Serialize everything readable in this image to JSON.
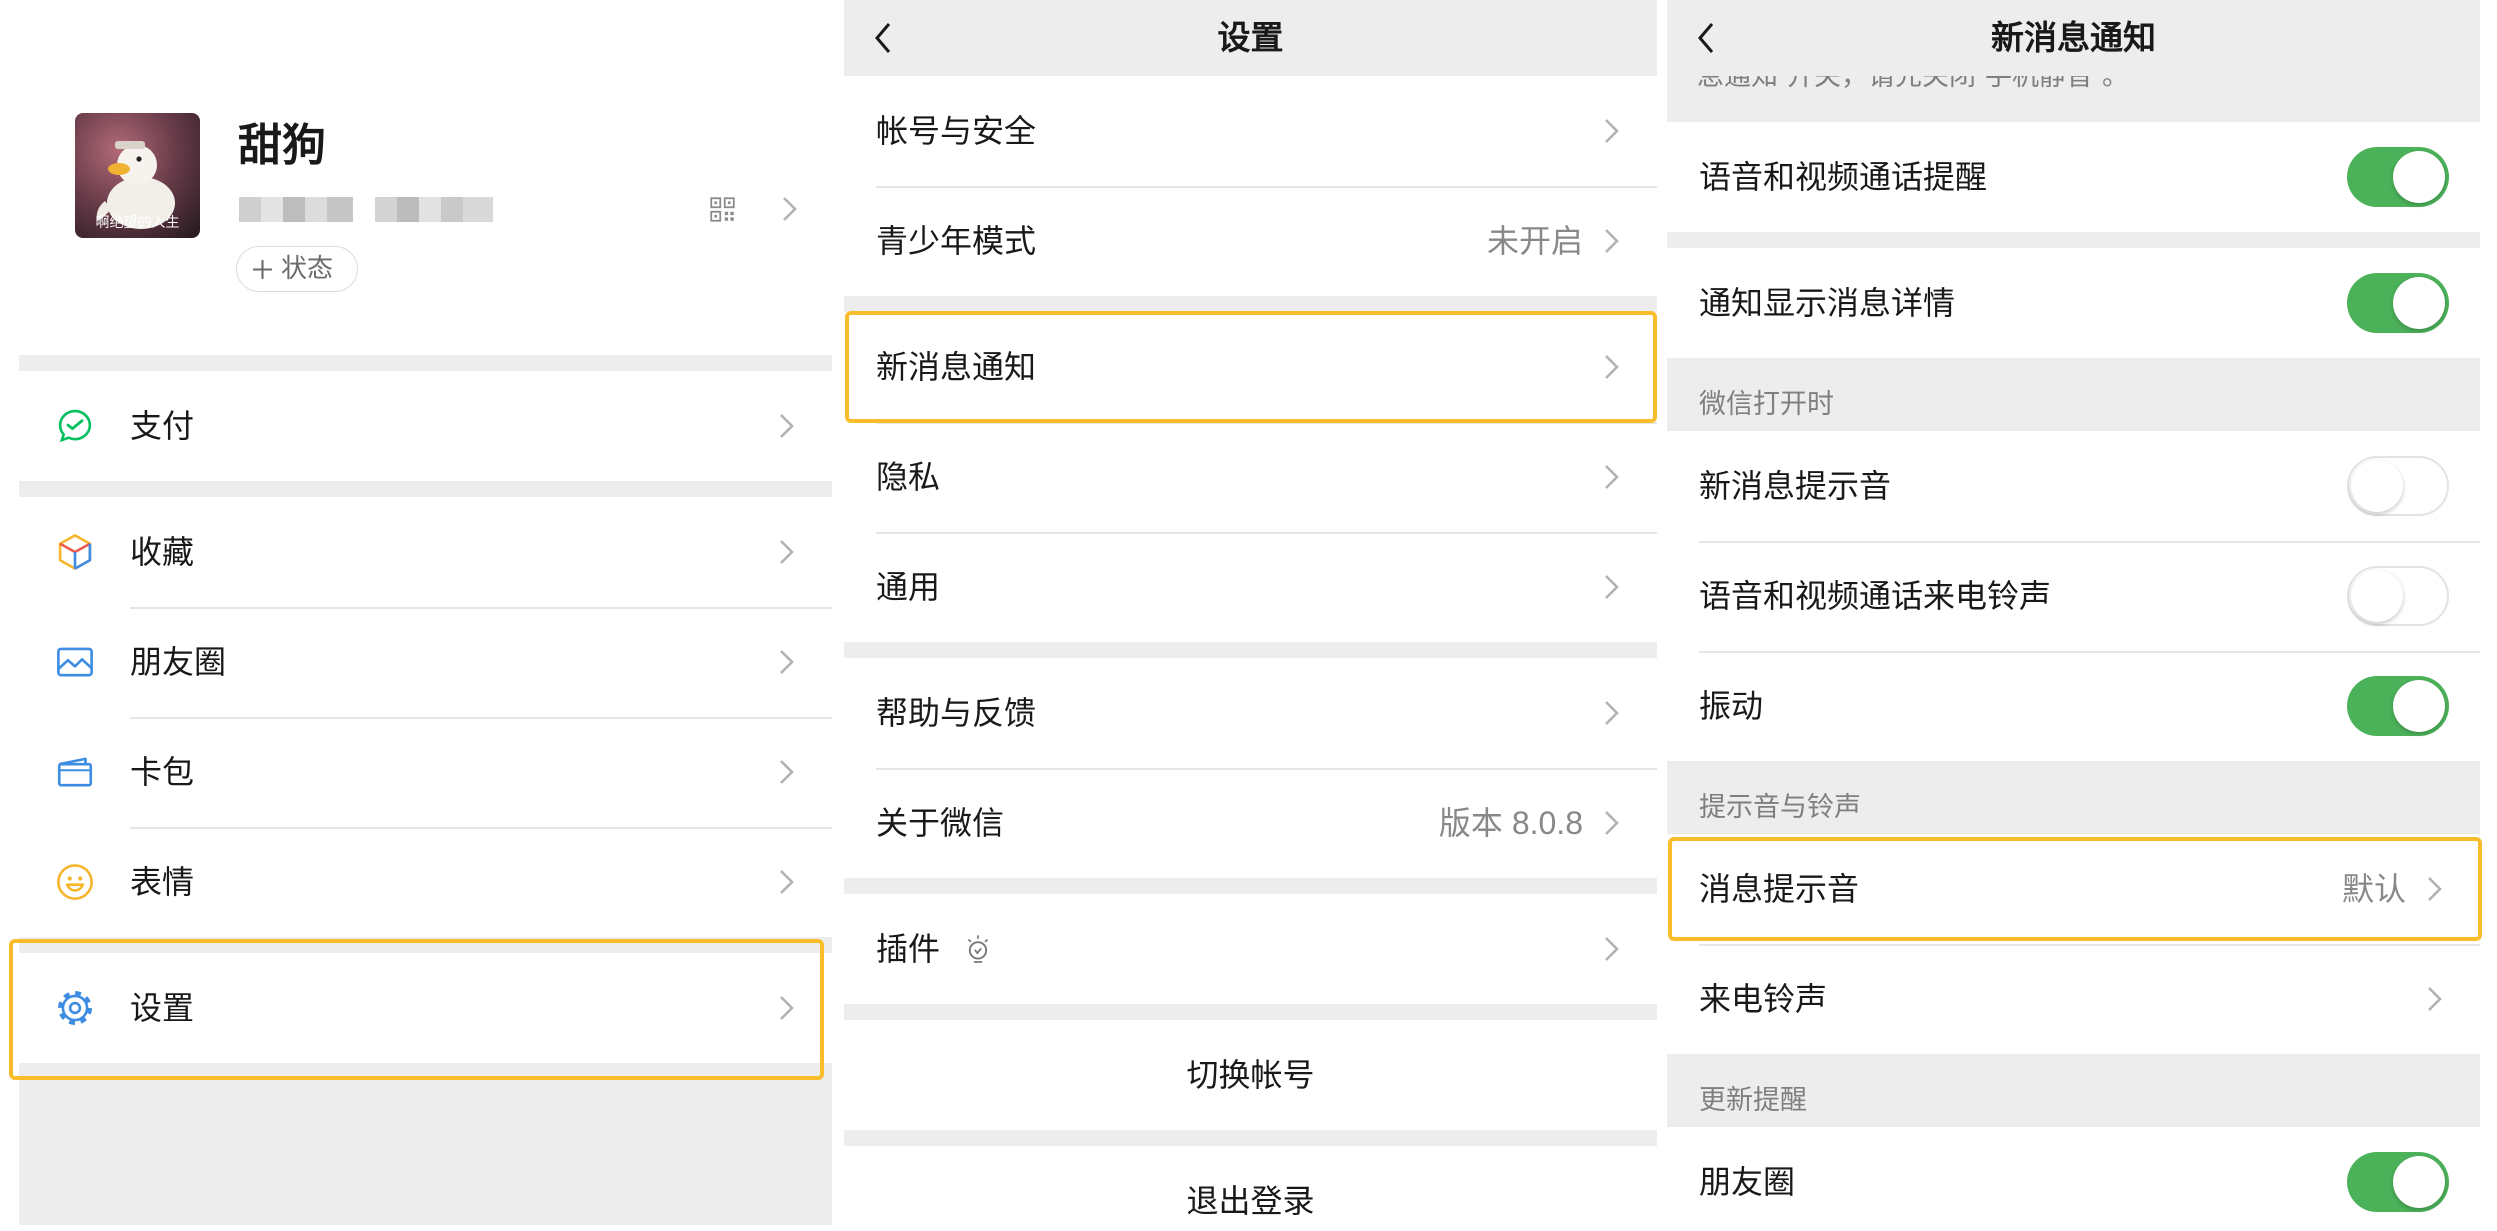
{
  "me": {
    "profile": {
      "name": "甜狗",
      "status_label": "状态",
      "avatar_caption": "啊绝望的人生"
    },
    "items": [
      {
        "label": "支付",
        "icon": "wechat-pay-icon"
      },
      {
        "label": "收藏",
        "icon": "favorites-cube-icon"
      },
      {
        "label": "朋友圈",
        "icon": "moments-picture-icon"
      },
      {
        "label": "卡包",
        "icon": "card-wallet-icon"
      },
      {
        "label": "表情",
        "icon": "sticker-smiley-icon"
      },
      {
        "label": "设置",
        "icon": "settings-gear-icon"
      }
    ]
  },
  "settings": {
    "title": "设置",
    "items": [
      {
        "label": "帐号与安全"
      },
      {
        "label": "青少年模式",
        "value": "未开启"
      },
      {
        "label": "新消息通知"
      },
      {
        "label": "隐私"
      },
      {
        "label": "通用"
      },
      {
        "label": "帮助与反馈"
      },
      {
        "label": "关于微信",
        "value": "版本 8.0.8"
      },
      {
        "label": "插件",
        "icon": "plugin-bulb-icon"
      }
    ],
    "switch_account": "切换帐号",
    "logout": "退出登录"
  },
  "notifications": {
    "title": "新消息通知",
    "note": "息通知”开关，请先关闭“手机静音”。",
    "top_rows": [
      {
        "label": "语音和视频通话提醒",
        "on": true
      },
      {
        "label": "通知显示消息详情",
        "on": true
      }
    ],
    "sections": [
      {
        "header": "微信打开时",
        "items": [
          {
            "label": "新消息提示音",
            "on": false
          },
          {
            "label": "语音和视频通话来电铃声",
            "on": false
          },
          {
            "label": "振动",
            "on": true
          }
        ]
      },
      {
        "header": "提示音与铃声",
        "items": [
          {
            "label": "消息提示音",
            "value": "默认"
          },
          {
            "label": "来电铃声"
          }
        ]
      },
      {
        "header": "更新提醒",
        "items": [
          {
            "label": "朋友圈",
            "on": true
          }
        ]
      }
    ]
  },
  "colors": {
    "highlight": "#F9BD2B",
    "toggle_on": "#4CB25A",
    "page_gray": "#EDEDED",
    "icon_blue": "#3E8DE3",
    "pay_green": "#07C160"
  }
}
